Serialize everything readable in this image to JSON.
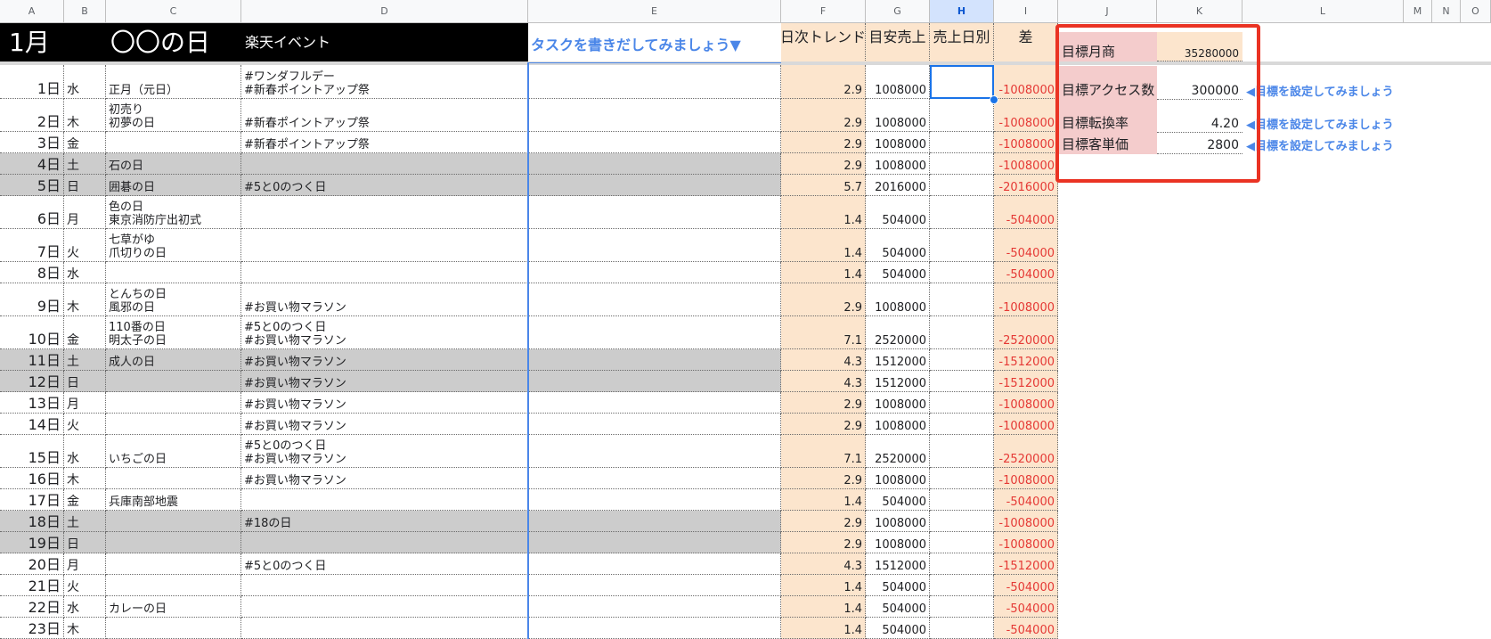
{
  "columns": [
    "A",
    "B",
    "C",
    "D",
    "E",
    "F",
    "G",
    "H",
    "I",
    "J",
    "K",
    "L",
    "M",
    "N",
    "O"
  ],
  "header": {
    "month": "1月",
    "day_title": "〇〇の日",
    "event_title": "楽天イベント",
    "task_prompt": "タスクを書きだしてみましょう▼",
    "trend": "日次トレンド",
    "target_sales": "目安売上",
    "daily_sales": "売上日別",
    "diff": "差"
  },
  "kpi": {
    "monthly_label": "目標月商",
    "monthly_value": "35280000",
    "access_label": "目標アクセス数",
    "access_value": "300000",
    "conversion_label": "目標転換率",
    "conversion_value": "4.20",
    "unit_price_label": "目標客単価",
    "unit_price_value": "2800",
    "hint": "◀目標を設定してみましょう"
  },
  "rows": [
    {
      "day": "1日",
      "wd": "水",
      "name": [
        "正月（元日）"
      ],
      "event": [
        "#ワンダフルデー",
        "#新春ポイントアップ祭"
      ],
      "trend": "2.9",
      "sales": "1008000",
      "diff": "-1008000",
      "weekend": false
    },
    {
      "day": "2日",
      "wd": "木",
      "name": [
        "初売り",
        "初夢の日"
      ],
      "event": [
        "#新春ポイントアップ祭"
      ],
      "trend": "2.9",
      "sales": "1008000",
      "diff": "-1008000",
      "weekend": false
    },
    {
      "day": "3日",
      "wd": "金",
      "name": [],
      "event": [
        "#新春ポイントアップ祭"
      ],
      "trend": "2.9",
      "sales": "1008000",
      "diff": "-1008000",
      "weekend": false
    },
    {
      "day": "4日",
      "wd": "土",
      "name": [
        "石の日"
      ],
      "event": [],
      "trend": "2.9",
      "sales": "1008000",
      "diff": "-1008000",
      "weekend": true
    },
    {
      "day": "5日",
      "wd": "日",
      "name": [
        "囲碁の日"
      ],
      "event": [
        "#5と0のつく日"
      ],
      "trend": "5.7",
      "sales": "2016000",
      "diff": "-2016000",
      "weekend": true
    },
    {
      "day": "6日",
      "wd": "月",
      "name": [
        "色の日",
        "東京消防庁出初式"
      ],
      "event": [],
      "trend": "1.4",
      "sales": "504000",
      "diff": "-504000",
      "weekend": false
    },
    {
      "day": "7日",
      "wd": "火",
      "name": [
        "七草がゆ",
        "爪切りの日"
      ],
      "event": [],
      "trend": "1.4",
      "sales": "504000",
      "diff": "-504000",
      "weekend": false
    },
    {
      "day": "8日",
      "wd": "水",
      "name": [],
      "event": [],
      "trend": "1.4",
      "sales": "504000",
      "diff": "-504000",
      "weekend": false
    },
    {
      "day": "9日",
      "wd": "木",
      "name": [
        "とんちの日",
        "風邪の日"
      ],
      "event": [
        "#お買い物マラソン"
      ],
      "trend": "2.9",
      "sales": "1008000",
      "diff": "-1008000",
      "weekend": false
    },
    {
      "day": "10日",
      "wd": "金",
      "name": [
        "110番の日",
        "明太子の日"
      ],
      "event": [
        "#5と0のつく日",
        "#お買い物マラソン"
      ],
      "trend": "7.1",
      "sales": "2520000",
      "diff": "-2520000",
      "weekend": false
    },
    {
      "day": "11日",
      "wd": "土",
      "name": [
        "成人の日"
      ],
      "event": [
        "#お買い物マラソン"
      ],
      "trend": "4.3",
      "sales": "1512000",
      "diff": "-1512000",
      "weekend": true
    },
    {
      "day": "12日",
      "wd": "日",
      "name": [],
      "event": [
        "#お買い物マラソン"
      ],
      "trend": "4.3",
      "sales": "1512000",
      "diff": "-1512000",
      "weekend": true
    },
    {
      "day": "13日",
      "wd": "月",
      "name": [],
      "event": [
        "#お買い物マラソン"
      ],
      "trend": "2.9",
      "sales": "1008000",
      "diff": "-1008000",
      "weekend": false
    },
    {
      "day": "14日",
      "wd": "火",
      "name": [],
      "event": [
        "#お買い物マラソン"
      ],
      "trend": "2.9",
      "sales": "1008000",
      "diff": "-1008000",
      "weekend": false
    },
    {
      "day": "15日",
      "wd": "水",
      "name": [
        "いちごの日"
      ],
      "event": [
        "#5と0のつく日",
        "#お買い物マラソン"
      ],
      "trend": "7.1",
      "sales": "2520000",
      "diff": "-2520000",
      "weekend": false
    },
    {
      "day": "16日",
      "wd": "木",
      "name": [],
      "event": [
        "#お買い物マラソン"
      ],
      "trend": "2.9",
      "sales": "1008000",
      "diff": "-1008000",
      "weekend": false
    },
    {
      "day": "17日",
      "wd": "金",
      "name": [
        "兵庫南部地震"
      ],
      "event": [],
      "trend": "1.4",
      "sales": "504000",
      "diff": "-504000",
      "weekend": false
    },
    {
      "day": "18日",
      "wd": "土",
      "name": [],
      "event": [
        "#18の日"
      ],
      "trend": "2.9",
      "sales": "1008000",
      "diff": "-1008000",
      "weekend": true
    },
    {
      "day": "19日",
      "wd": "日",
      "name": [],
      "event": [],
      "trend": "2.9",
      "sales": "1008000",
      "diff": "-1008000",
      "weekend": true
    },
    {
      "day": "20日",
      "wd": "月",
      "name": [],
      "event": [
        "#5と0のつく日"
      ],
      "trend": "4.3",
      "sales": "1512000",
      "diff": "-1512000",
      "weekend": false
    },
    {
      "day": "21日",
      "wd": "火",
      "name": [],
      "event": [],
      "trend": "1.4",
      "sales": "504000",
      "diff": "-504000",
      "weekend": false
    },
    {
      "day": "22日",
      "wd": "水",
      "name": [
        "カレーの日"
      ],
      "event": [],
      "trend": "1.4",
      "sales": "504000",
      "diff": "-504000",
      "weekend": false
    },
    {
      "day": "23日",
      "wd": "木",
      "name": [],
      "event": [],
      "trend": "1.4",
      "sales": "504000",
      "diff": "-504000",
      "weekend": false
    }
  ]
}
